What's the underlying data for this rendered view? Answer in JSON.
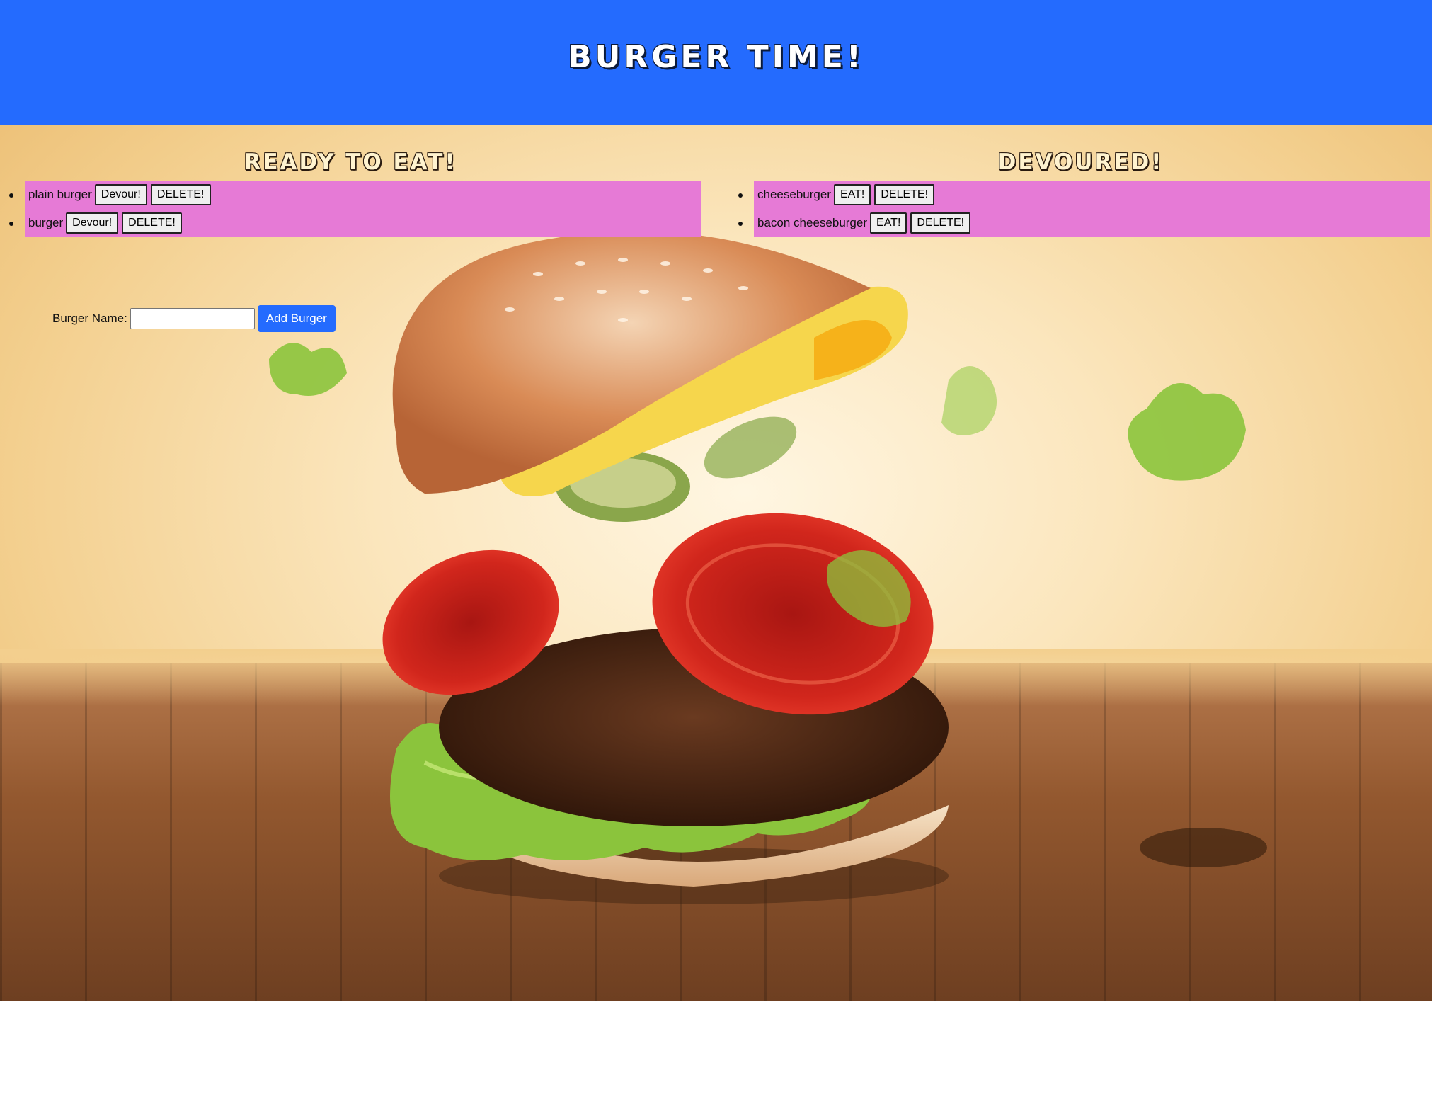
{
  "header": {
    "title": "BURGER TIME!"
  },
  "ready": {
    "heading": "READY TO EAT!",
    "items": [
      {
        "name": "plain burger",
        "primary_label": "Devour!",
        "delete_label": "DELETE!"
      },
      {
        "name": "burger",
        "primary_label": "Devour!",
        "delete_label": "DELETE!"
      }
    ]
  },
  "devoured": {
    "heading": "DEVOURED!",
    "items": [
      {
        "name": "cheeseburger",
        "primary_label": "EAT!",
        "delete_label": "DELETE!"
      },
      {
        "name": "bacon cheeseburger",
        "primary_label": "EAT!",
        "delete_label": "DELETE!"
      }
    ]
  },
  "form": {
    "label": "Burger Name:",
    "input_value": "",
    "input_placeholder": "",
    "submit_label": "Add Burger"
  },
  "colors": {
    "header_bg": "#246bfe",
    "list_bg": "#e67ad6",
    "button_primary": "#246bfe"
  }
}
